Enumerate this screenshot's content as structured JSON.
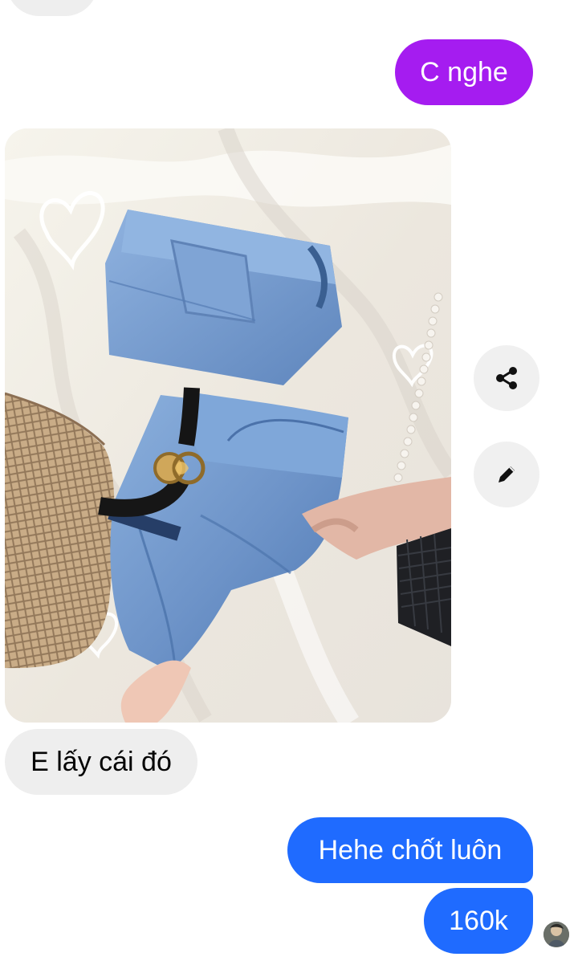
{
  "messages": {
    "outgoing_1": "C nghe",
    "incoming_1": "E lấy cái đó",
    "outgoing_2": "Hehe chốt luôn",
    "outgoing_3": "160k"
  },
  "photo": {
    "subject": "denim shorts photo attachment"
  },
  "actions": {
    "share_icon": "share-icon",
    "edit_icon": "pencil-icon"
  },
  "colors": {
    "outgoing_purple": "#a51cf0",
    "outgoing_blue": "#1f6bff",
    "incoming_gray": "#eeeeee"
  }
}
